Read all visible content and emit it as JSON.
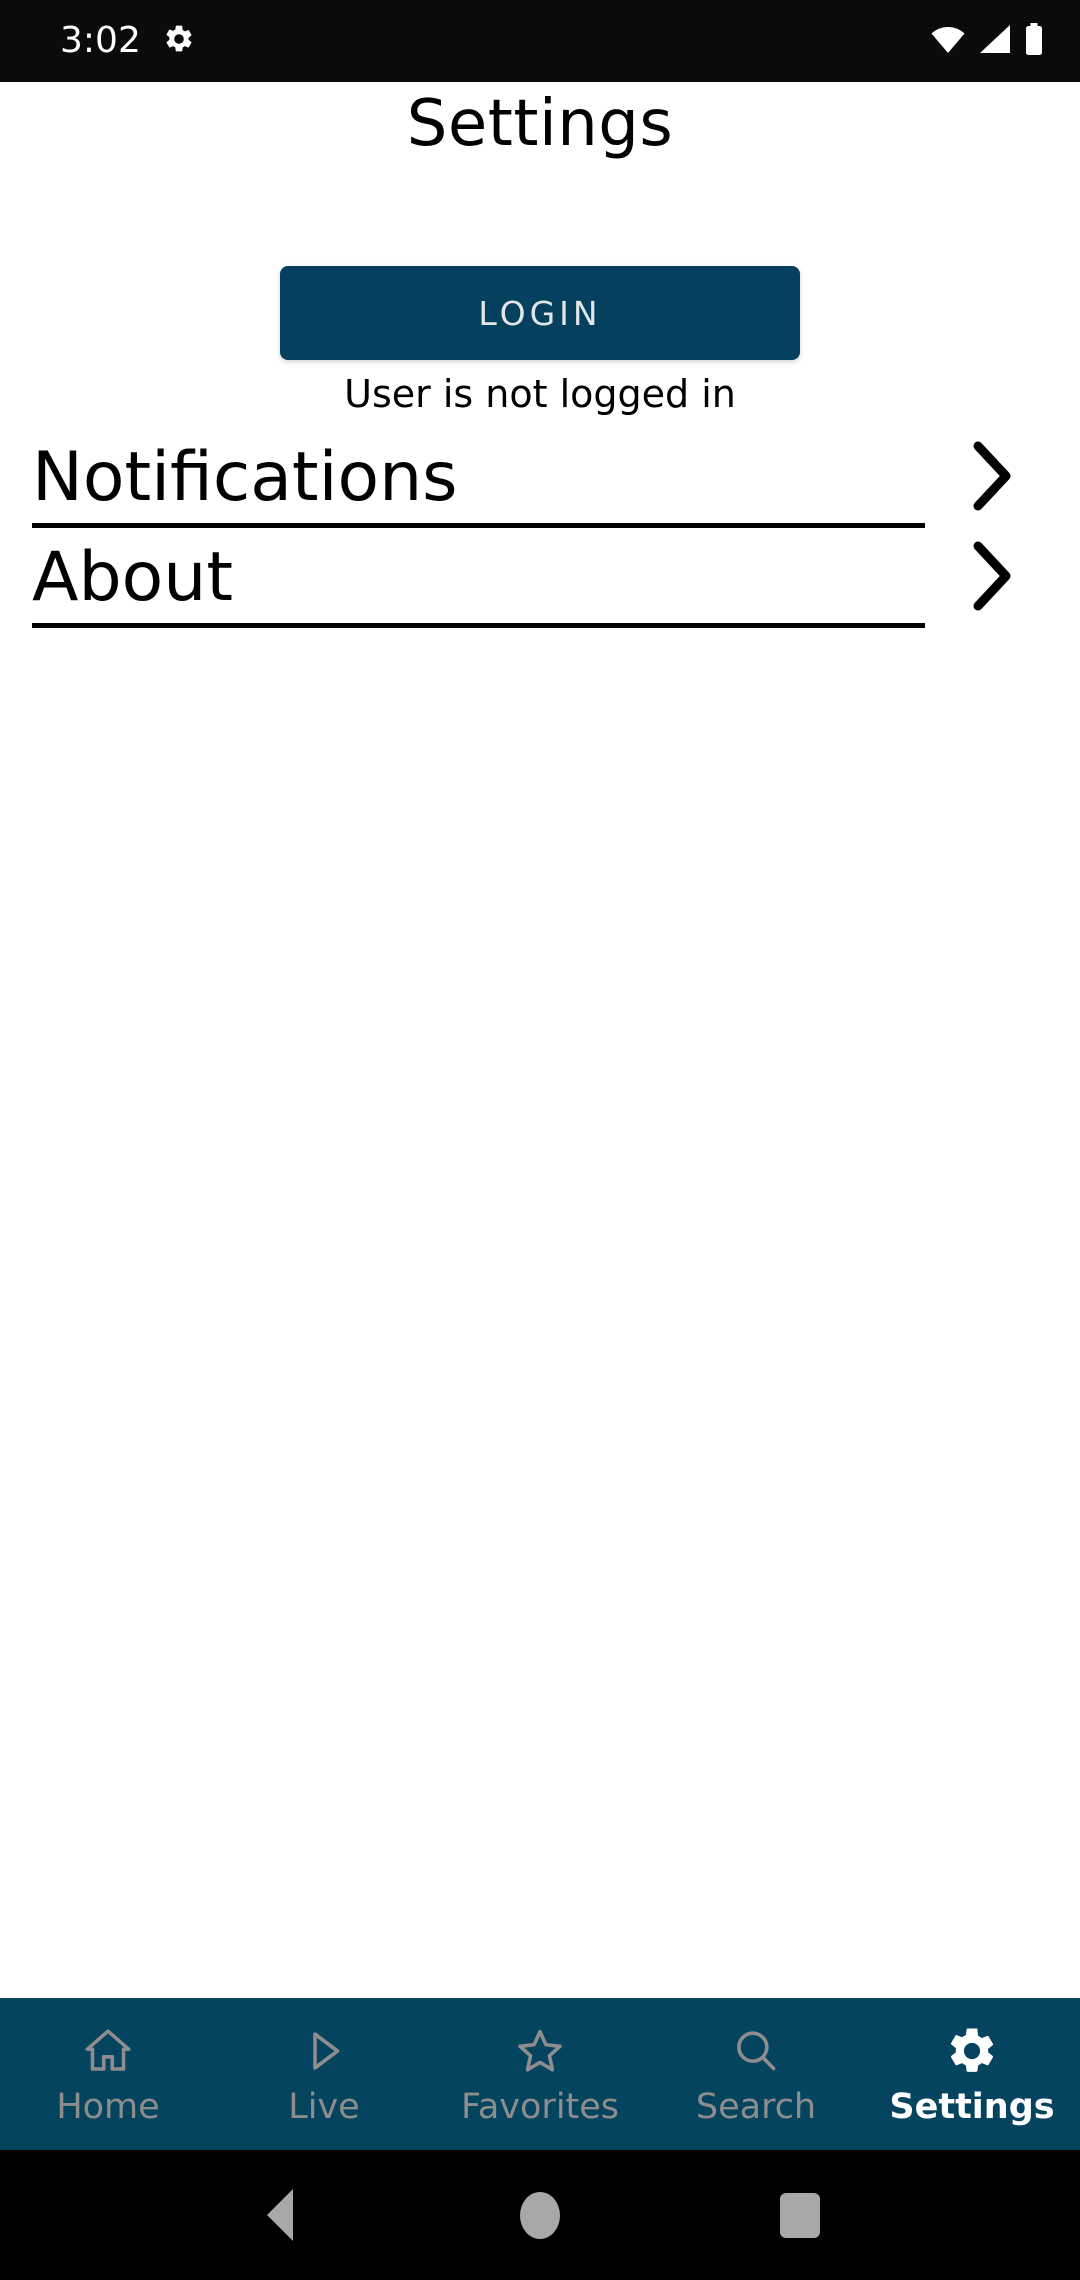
{
  "status_bar": {
    "time": "3:02",
    "left_icons": [
      "gear-icon"
    ],
    "right_icons": [
      "wifi-icon",
      "cellular-signal-icon",
      "battery-icon"
    ]
  },
  "header": {
    "title": "Settings"
  },
  "account": {
    "login_label": "LOGIN",
    "status_text": "User is not logged in"
  },
  "settings_list": [
    {
      "label": "Notifications",
      "accessory": "chevron-right-icon"
    },
    {
      "label": "About",
      "accessory": "chevron-right-icon"
    }
  ],
  "tab_bar": {
    "active": "Settings",
    "items": [
      {
        "label": "Home",
        "icon": "home-icon",
        "active": false
      },
      {
        "label": "Live",
        "icon": "play-icon",
        "active": false
      },
      {
        "label": "Favorites",
        "icon": "star-icon",
        "active": false
      },
      {
        "label": "Search",
        "icon": "search-icon",
        "active": false
      },
      {
        "label": "Settings",
        "icon": "gear-icon",
        "active": true
      }
    ]
  },
  "system_nav": {
    "buttons": [
      "back-button",
      "home-button",
      "recents-button"
    ]
  },
  "colors": {
    "accent": "#05405e",
    "tab_bar_background": "#05445f",
    "tab_inactive": "#8d8d8d",
    "tab_active": "#ffffff",
    "status_bar_background": "#0b0b0b",
    "page_background": "#ffffff",
    "text": "#000000"
  }
}
